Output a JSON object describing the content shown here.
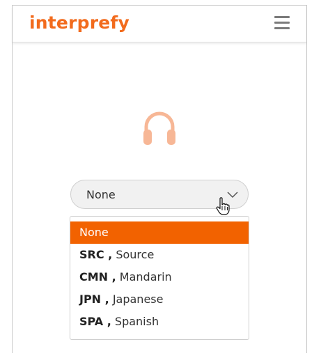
{
  "header": {
    "logo_text": "interprefy",
    "menu_icon": "hamburger-menu-icon"
  },
  "main": {
    "audio_icon": "headphones-icon",
    "language_select": {
      "value": "None",
      "options": [
        {
          "code": "",
          "name": "None",
          "selected": true
        },
        {
          "code": "SRC ,",
          "name": "Source",
          "selected": false
        },
        {
          "code": "CMN ,",
          "name": "Mandarin",
          "selected": false
        },
        {
          "code": "JPN ,",
          "name": "Japanese",
          "selected": false
        },
        {
          "code": "SPA ,",
          "name": "Spanish",
          "selected": false
        }
      ]
    }
  },
  "colors": {
    "brand": "#f26b1d",
    "selected_option": "#f26200",
    "headphones": "#f7b796"
  }
}
